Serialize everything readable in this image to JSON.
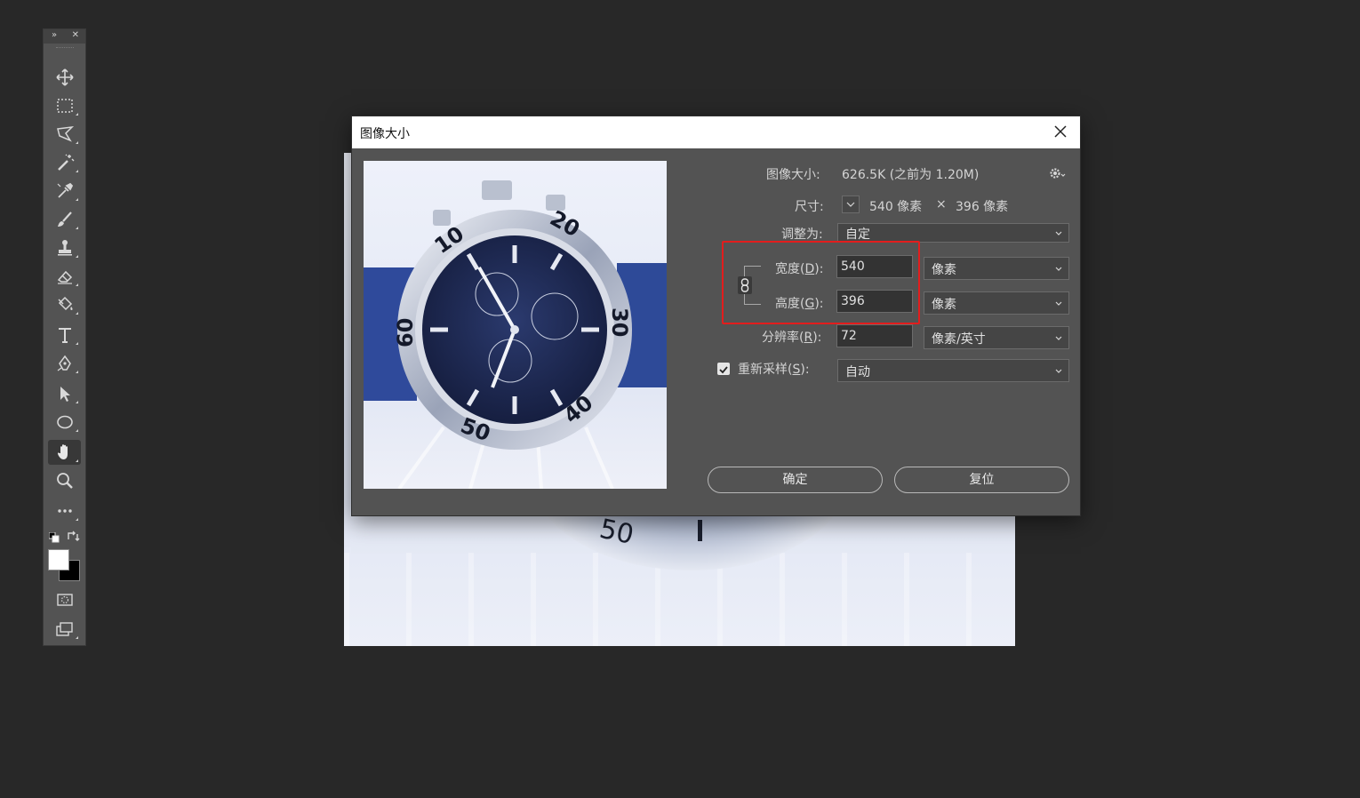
{
  "toolbar": {
    "collapse_glyph": "»",
    "close_glyph": "✕",
    "tools": [
      {
        "name": "move-tool",
        "icon": "move-icon"
      },
      {
        "name": "marquee-tool",
        "icon": "rect-marquee-icon"
      },
      {
        "name": "lasso-tool",
        "icon": "polygon-lasso-icon"
      },
      {
        "name": "magic-wand-tool",
        "icon": "magic-wand-icon"
      },
      {
        "name": "eyedropper-tool",
        "icon": "eyedropper-icon"
      },
      {
        "name": "brush-tool",
        "icon": "brush-icon"
      },
      {
        "name": "stamp-tool",
        "icon": "stamp-icon"
      },
      {
        "name": "eraser-tool",
        "icon": "eraser-icon"
      },
      {
        "name": "paint-bucket-tool",
        "icon": "paint-bucket-icon"
      },
      {
        "name": "type-tool",
        "icon": "type-icon"
      },
      {
        "name": "pen-tool",
        "icon": "pen-icon"
      },
      {
        "name": "path-select-tool",
        "icon": "arrow-icon"
      },
      {
        "name": "ellipse-tool",
        "icon": "ellipse-icon"
      },
      {
        "name": "hand-tool",
        "icon": "hand-icon",
        "active": true
      },
      {
        "name": "zoom-tool",
        "icon": "zoom-icon"
      },
      {
        "name": "more-tools",
        "icon": "ellipsis-icon"
      }
    ],
    "foreground_color": "#ffffff",
    "background_color": "#000000"
  },
  "dialog": {
    "title": "图像大小",
    "image_size_label": "图像大小:",
    "image_size_value": "626.5K (之前为 1.20M)",
    "dimensions_label": "尺寸:",
    "dimensions_width": "540 像素",
    "dimensions_times": "×",
    "dimensions_height": "396 像素",
    "fit_to_label": "调整为:",
    "fit_to_value": "自定",
    "width_label_prefix": "宽度(",
    "width_label_key": "D",
    "width_label_suffix": "):",
    "width_value": "540",
    "width_unit": "像素",
    "height_label_prefix": "高度(",
    "height_label_key": "G",
    "height_label_suffix": "):",
    "height_value": "396",
    "height_unit": "像素",
    "resolution_label_prefix": "分辨率(",
    "resolution_label_key": "R",
    "resolution_label_suffix": "):",
    "resolution_value": "72",
    "resolution_unit": "像素/英寸",
    "resample_label_prefix": "重新采样(",
    "resample_label_key": "S",
    "resample_label_suffix": "):",
    "resample_checked": true,
    "resample_value": "自动",
    "ok_label": "确定",
    "reset_label": "复位",
    "highlight_color": "#e21d1d"
  },
  "preview": {
    "dial_numbers": [
      "10",
      "20",
      "30",
      "40",
      "50",
      "60"
    ]
  }
}
